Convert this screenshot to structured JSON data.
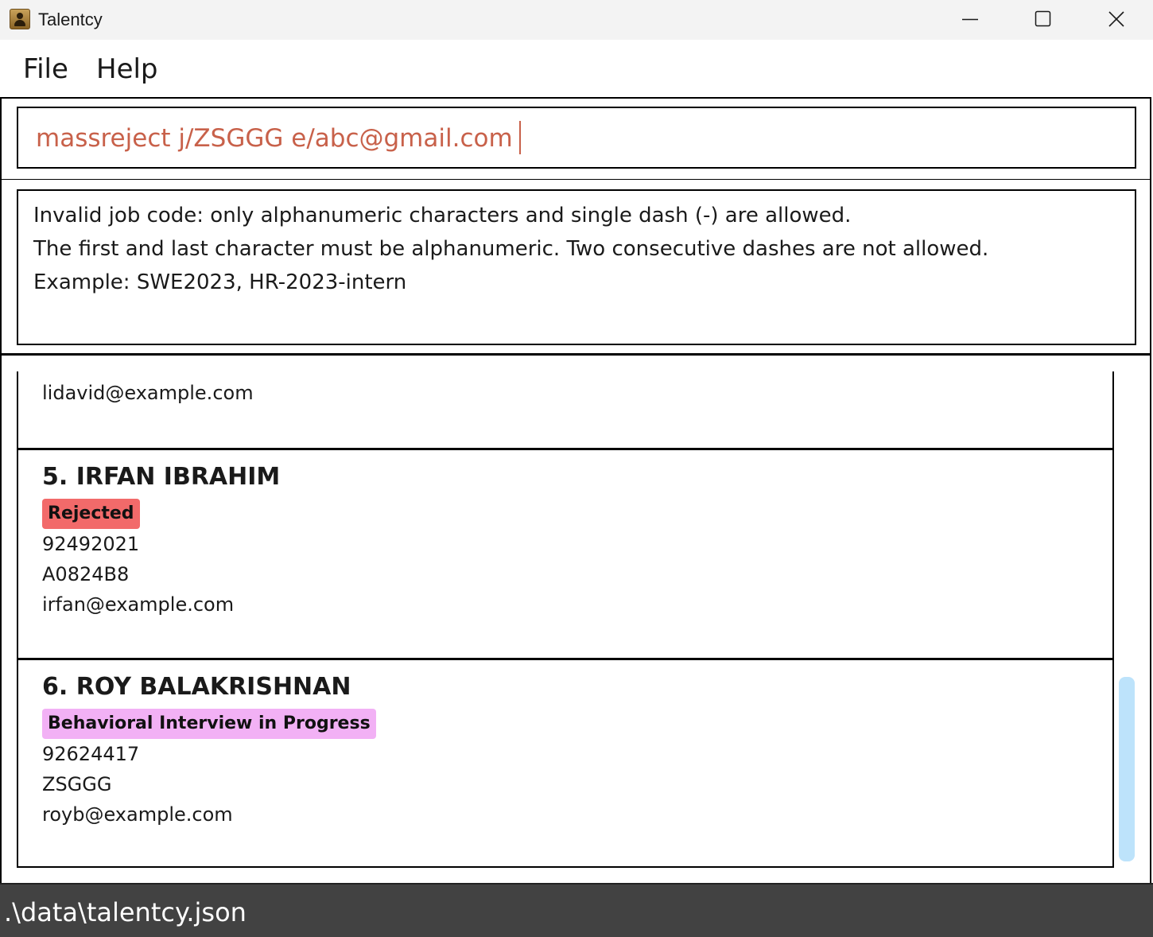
{
  "window": {
    "title": "Talentcy",
    "app_icon": "contact-book-icon"
  },
  "menu": {
    "items": [
      {
        "label": "File"
      },
      {
        "label": "Help"
      }
    ]
  },
  "command": {
    "value": "massreject j/ZSGGG e/abc@gmail.com",
    "text_color": "#c8614a"
  },
  "result": {
    "lines": [
      "Invalid job code: only alphanumeric characters and single dash (-) are allowed.",
      "The first and last character must be alphanumeric. Two consecutive dashes are not allowed.",
      "Example: SWE2023, HR-2023-intern"
    ]
  },
  "list": {
    "partial_card": {
      "email": "lidavid@example.com"
    },
    "cards": [
      {
        "title": "5. IRFAN IBRAHIM",
        "status": "Rejected",
        "status_color": "#f26a6a",
        "phone": "92492021",
        "job_code": "A0824B8",
        "email": "irfan@example.com"
      },
      {
        "title": "6. ROY BALAKRISHNAN",
        "status": "Behavioral Interview in Progress",
        "status_color": "#f2b1f5",
        "phone": "92624417",
        "job_code": "ZSGGG",
        "email": "royb@example.com"
      }
    ],
    "scrollbar_color": "#bde3fb"
  },
  "status_bar": {
    "path": ".\\data\\talentcy.json",
    "background": "#424242"
  }
}
